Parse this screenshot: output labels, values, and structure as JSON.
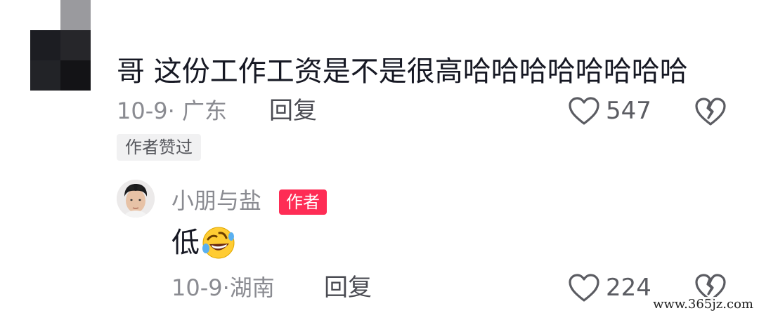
{
  "comment": {
    "text": "哥 这份工作工资是不是很高哈哈哈哈哈哈哈哈",
    "date": "10-9",
    "location": "广东",
    "reply_label": "回复",
    "like_count": "547",
    "liked_by_author_badge": "作者赞过"
  },
  "reply": {
    "username": "小朋与盐",
    "author_tag": "作者",
    "text": "低",
    "emoji": "rolling-on-floor-laughing-emoji",
    "date": "10-9",
    "location": "湖南",
    "reply_label": "回复",
    "like_count": "224"
  },
  "icons": {
    "like": "heart-outline-icon",
    "dislike": "broken-heart-icon"
  },
  "watermark": "www.365jz.com",
  "colors": {
    "author_tag_bg": "#fe2c55",
    "meta_text": "#8a8b91",
    "badge_bg": "#f1f1f2"
  }
}
